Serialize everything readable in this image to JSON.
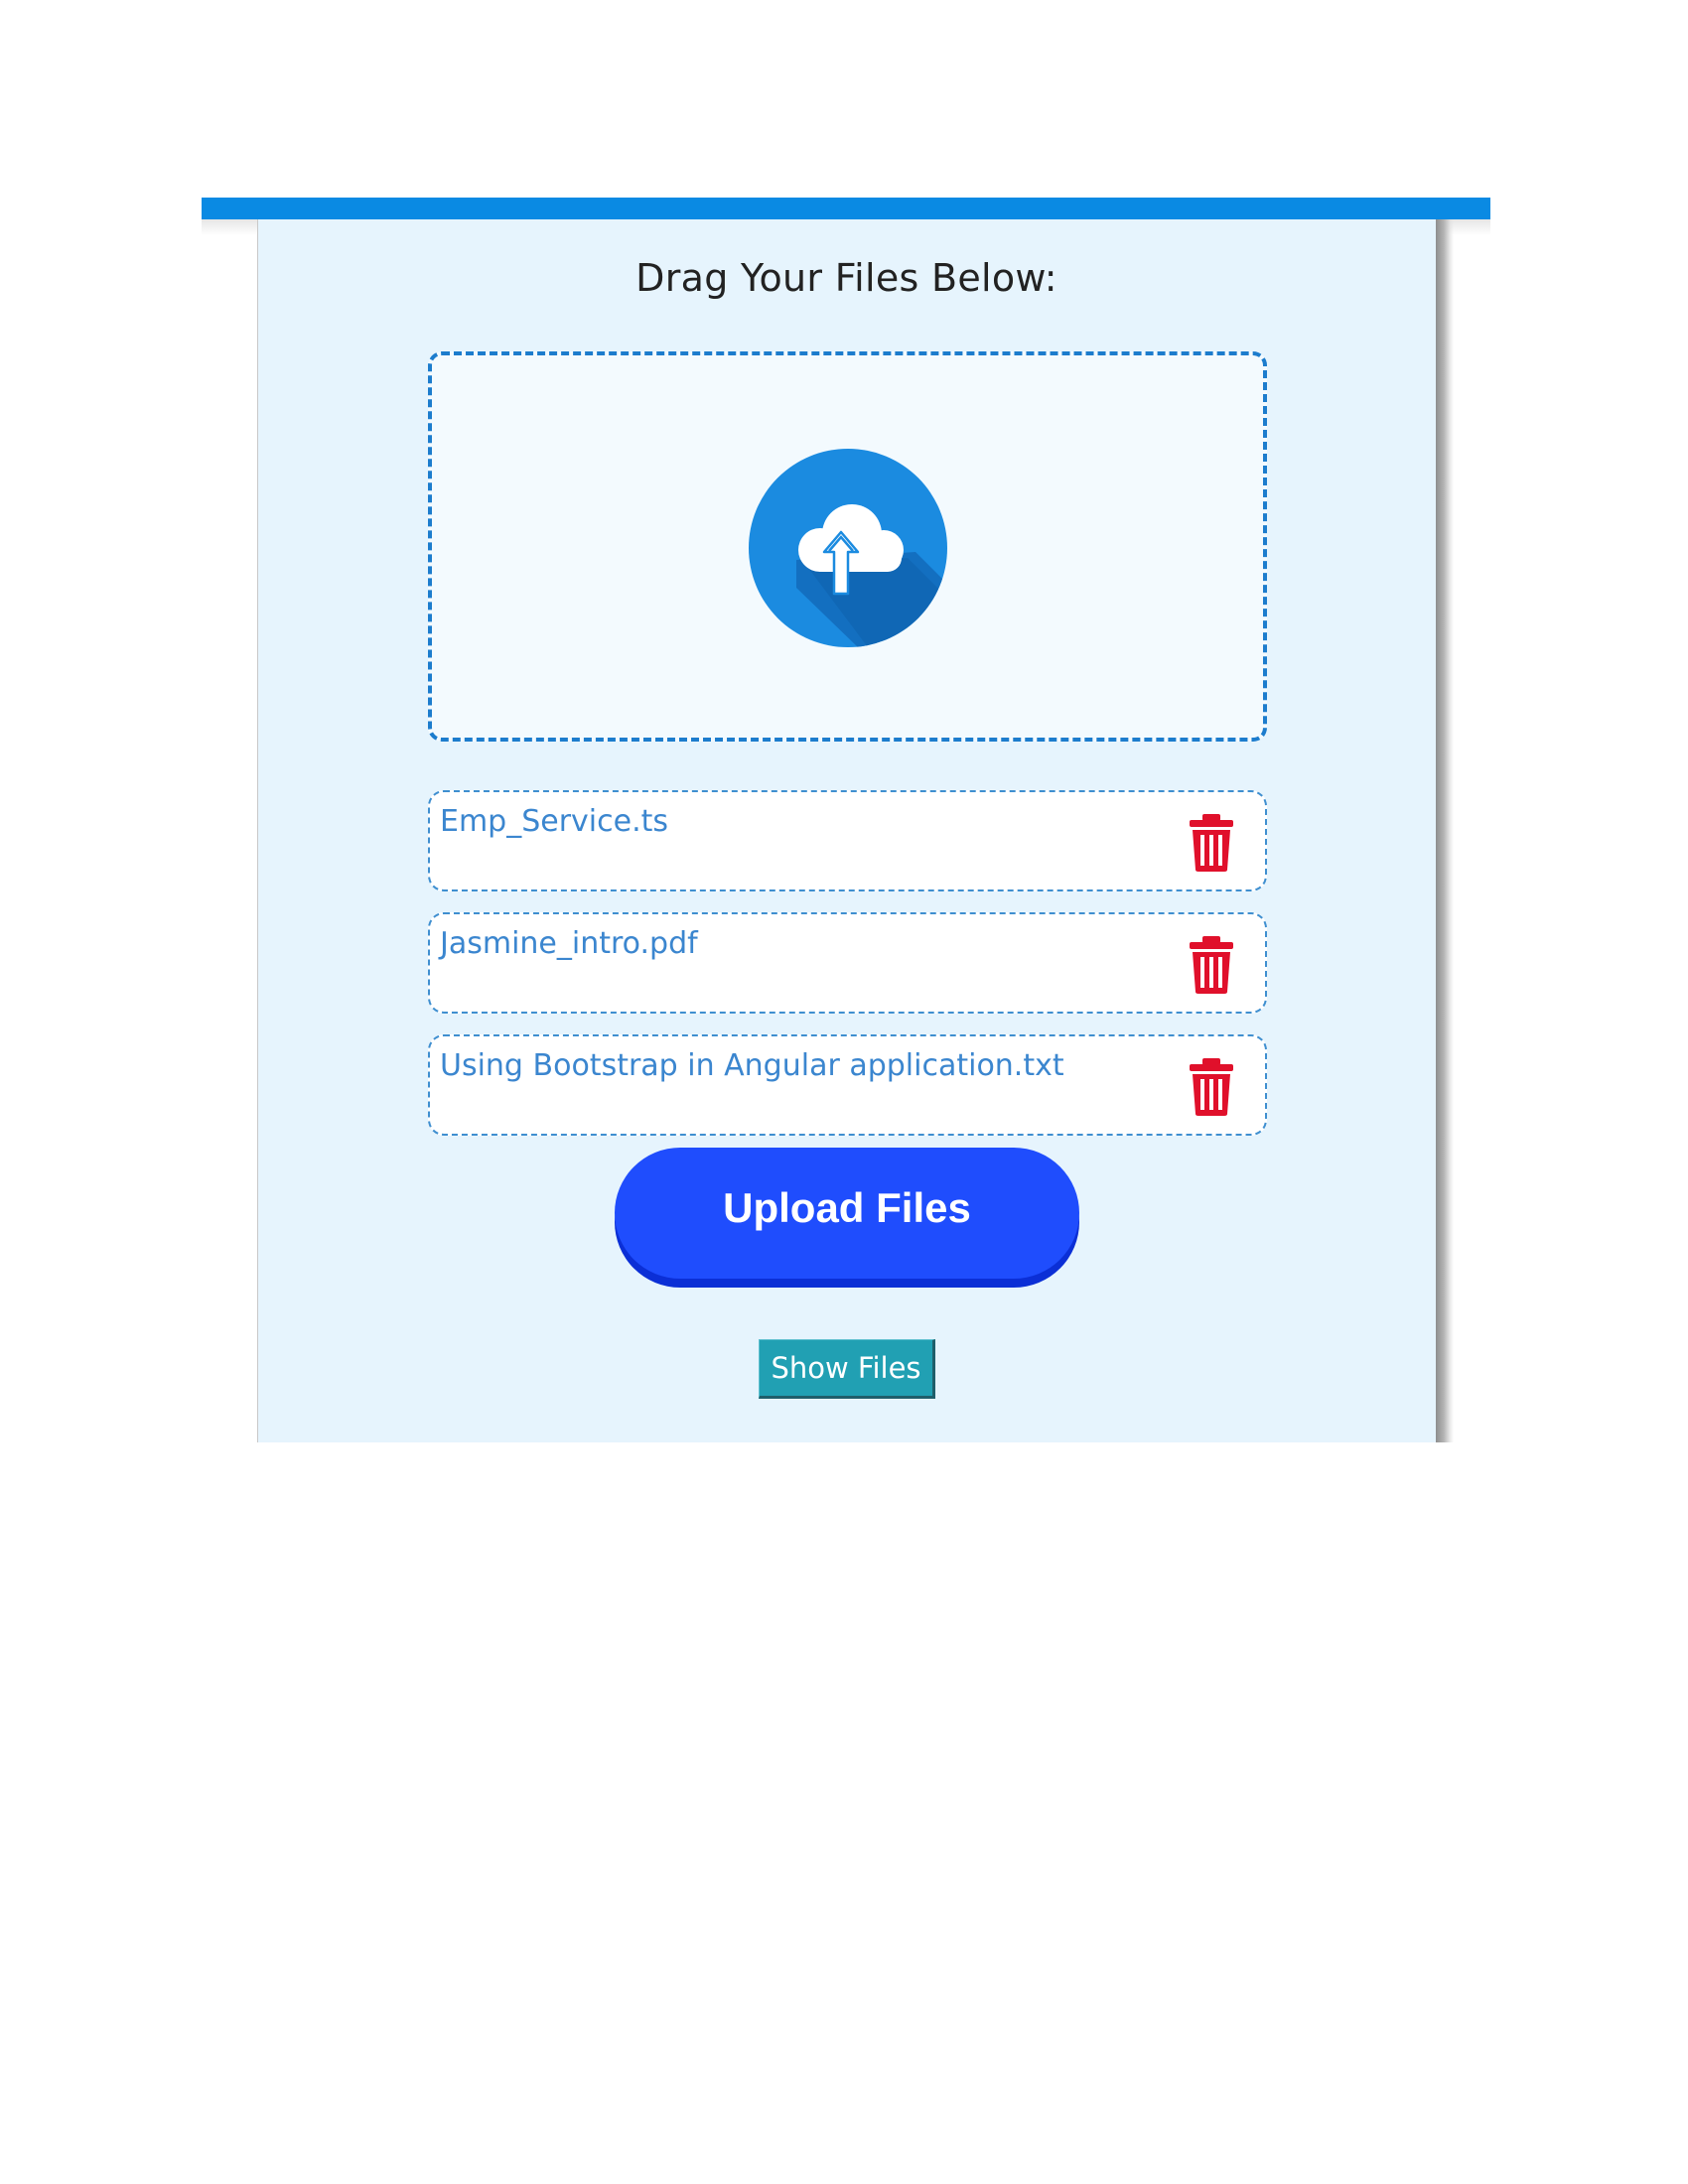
{
  "header": {
    "title": "Drag Your Files Below:"
  },
  "drop_zone": {
    "icon": "cloud-upload-icon"
  },
  "files": [
    {
      "name": "Emp_Service.ts",
      "action_icon": "trash-icon"
    },
    {
      "name": "Jasmine_intro.pdf",
      "action_icon": "trash-icon"
    },
    {
      "name": "Using Bootstrap in Angular application.txt",
      "action_icon": "trash-icon"
    }
  ],
  "actions": {
    "upload_label": "Upload Files",
    "show_label": "Show Files"
  },
  "colors": {
    "accent_bar": "#0a8ae3",
    "panel_bg": "#e6f4fd",
    "file_text": "#3b86cf",
    "delete_red": "#e0102b",
    "upload_button": "#1f4dfd",
    "show_button": "#21a0b3"
  }
}
